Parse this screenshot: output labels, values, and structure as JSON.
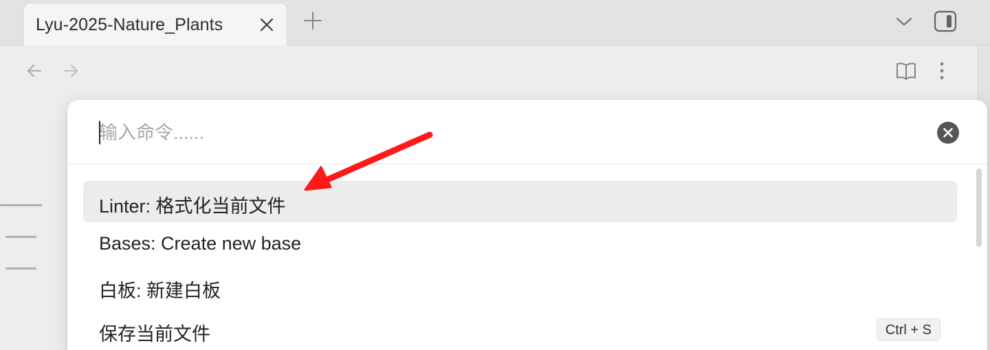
{
  "tab": {
    "title": "Lyu-2025-Nature_Plants"
  },
  "icons": {
    "tab_close": "close-icon",
    "new_tab": "plus-icon",
    "tab_list": "chevron-down-icon",
    "sidebar_toggle": "sidebar-toggle-icon",
    "back": "arrow-left-icon",
    "forward": "arrow-right-icon",
    "reading_view": "book-open-icon",
    "more": "more-vertical-icon",
    "clear": "close-circle-icon"
  },
  "palette": {
    "placeholder": "输入命令......",
    "value": "",
    "items": [
      {
        "label": "Linter: 格式化当前文件",
        "hotkey": "",
        "selected": true
      },
      {
        "label": "Bases: Create new base",
        "hotkey": "",
        "selected": false
      },
      {
        "label": "白板: 新建白板",
        "hotkey": "",
        "selected": false
      },
      {
        "label": "保存当前文件",
        "hotkey": "Ctrl + S",
        "selected": false
      }
    ]
  },
  "colors": {
    "annotation_arrow": "#ff1a1a",
    "selected_row": "#ececec",
    "background": "#ebebeb"
  }
}
